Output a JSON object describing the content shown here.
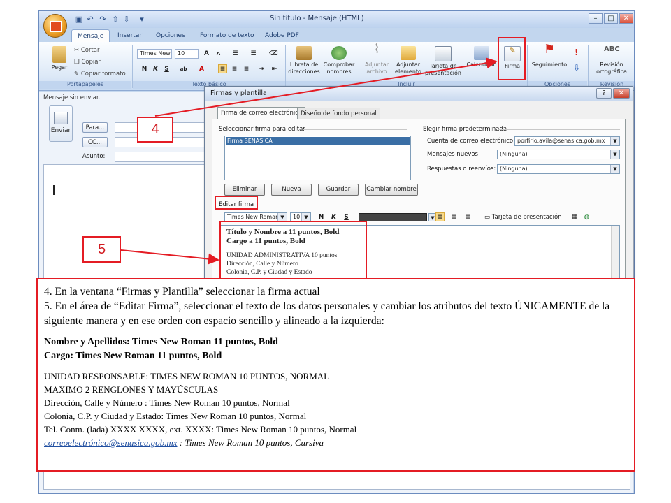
{
  "window": {
    "title": "Sin título - Mensaje (HTML)",
    "tabs": [
      "Mensaje",
      "Insertar",
      "Opciones",
      "Formato de texto",
      "Adobe PDF"
    ],
    "active_tab": "Mensaje"
  },
  "ribbon": {
    "clipboard": {
      "paste": "Pegar",
      "cut": "Cortar",
      "copy": "Copiar",
      "format_painter": "Copiar formato",
      "group": "Portapapeles"
    },
    "basic_text": {
      "font": "Times New",
      "size": "10",
      "group": "Texto básico"
    },
    "include": {
      "address_book": "Libreta de direcciones",
      "check_names": "Comprobar nombres",
      "attach_file": "Adjuntar archivo",
      "attach_item": "Adjuntar elemento",
      "business_card": "Tarjeta de presentación",
      "calendar": "Calendario",
      "signature": "Firma",
      "group": "Incluir"
    },
    "options": {
      "follow_up": "Seguimiento",
      "group": "Opciones"
    },
    "proofing": {
      "spelling": "Revisión ortográfica",
      "group": "Revisión"
    }
  },
  "message": {
    "info": "Mensaje sin enviar.",
    "send": "Enviar",
    "to": "Para...",
    "cc": "CC...",
    "subject": "Asunto:"
  },
  "dialog": {
    "title": "Firmas y plantilla",
    "tabs": [
      "Firma de correo electrónico",
      "Diseño de fondo personal"
    ],
    "select_label": "Seleccionar firma para editar",
    "signatures": [
      "Firma SENASICA"
    ],
    "buttons": {
      "delete": "Eliminar",
      "new": "Nueva",
      "save": "Guardar",
      "rename": "Cambiar nombre"
    },
    "default_label": "Elegir firma predeterminada",
    "account_label": "Cuenta de correo electrónico:",
    "account_value": "porfirio.avila@senasica.gob.mx",
    "new_messages_label": "Mensajes nuevos:",
    "new_messages_value": "(Ninguna)",
    "replies_label": "Respuestas o reenvíos:",
    "replies_value": "(Ninguna)",
    "edit_label": "Editar firma",
    "edit_font": "Times New Roman",
    "edit_size": "10",
    "business_card": "Tarjeta de presentación",
    "signature_lines": [
      "Título y Nombre a 11 puntos, Bold",
      "Cargo a 11 puntos, Bold",
      "UNIDAD ADMINISTRATIVA 10 puntos",
      "Dirección, Calle y Número",
      "Colonia, C.P. y Ciudad y Estado"
    ]
  },
  "callouts": {
    "step4": "4",
    "step5": "5"
  },
  "instructions": {
    "line1": "4. En la ventana “Firmas y Plantilla” seleccionar la firma actual",
    "line2": "5. En el área de “Editar Firma”, seleccionar el texto de los datos personales y cambiar los atributos del texto ÚNICAMENTE de la siguiente manera y en ese orden con espacio sencillo y alineado a la izquierda:",
    "name_line": "Nombre y Apellidos: Times New Roman 11 puntos, Bold",
    "cargo_line": "Cargo: Times New Roman 11 puntos, Bold",
    "unit_line": "UNIDAD RESPONSABLE: TIMES NEW ROMAN 10 PUNTOS, NORMAL",
    "max_line": "MAXIMO 2 RENGLONES Y MAYÚSCULAS",
    "address_line": "Dirección, Calle y Número : Times New Roman 10 puntos, Normal",
    "colonia_line": "Colonia, C.P. y Ciudad y Estado: Times New Roman 10 puntos, Normal",
    "tel_line": "Tel. Conm. (lada) XXXX XXXX, ext. XXXX: Times New Roman 10 puntos, Normal",
    "email_link": "correoelectrónico@senasica.gob.mx",
    "email_suffix": " : Times New Roman 10 puntos, Cursiva"
  },
  "colors": {
    "annotation_red": "#e41c24",
    "selection_blue": "#3a6ea5",
    "ribbon_blue": "#c5d8ee"
  }
}
